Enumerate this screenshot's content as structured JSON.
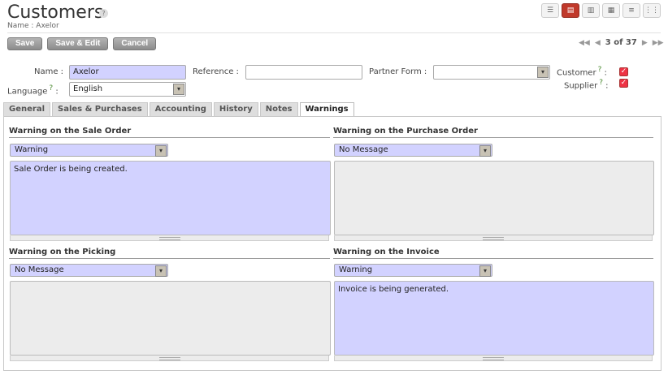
{
  "header": {
    "title": "Customers",
    "help": "?",
    "subtitle": "Name : Axelor"
  },
  "views": [
    {
      "icon": "list-view-icon",
      "glyph": "☰"
    },
    {
      "icon": "form-view-icon",
      "glyph": "▤"
    },
    {
      "icon": "chart-view-icon",
      "glyph": "▥"
    },
    {
      "icon": "calendar-view-icon",
      "glyph": "▦"
    },
    {
      "icon": "gantt-view-icon",
      "glyph": "≡"
    },
    {
      "icon": "kanban-view-icon",
      "glyph": "⋮⋮"
    }
  ],
  "toolbar": {
    "save_label": "Save",
    "save_edit_label": "Save & Edit",
    "cancel_label": "Cancel"
  },
  "pager": {
    "first": "◀◀",
    "prev": "◀",
    "count": "3 of 37",
    "next": "▶",
    "last": "▶▶"
  },
  "form": {
    "name_label": "Name :",
    "name_value": "Axelor",
    "reference_label": "Reference :",
    "reference_value": "",
    "partner_form_label": "Partner Form :",
    "partner_form_value": "",
    "language_label": "Language",
    "language_help": "?",
    "language_sep": ":",
    "language_value": "English",
    "customer_label": "Customer",
    "customer_help": "?",
    "customer_sep": ":",
    "customer_checked": true,
    "supplier_label": "Supplier",
    "supplier_help": "?",
    "supplier_sep": ":",
    "supplier_checked": true,
    "check_glyph": "✓",
    "arrow_glyph": "▾"
  },
  "tabs": [
    {
      "label": "General"
    },
    {
      "label": "Sales & Purchases"
    },
    {
      "label": "Accounting"
    },
    {
      "label": "History"
    },
    {
      "label": "Notes"
    },
    {
      "label": "Warnings",
      "active": true
    }
  ],
  "warnings": {
    "sale": {
      "title": "Warning on the Sale Order",
      "select": "Warning",
      "text": "Sale Order is being created."
    },
    "purchase": {
      "title": "Warning on the Purchase Order",
      "select": "No Message",
      "text": ""
    },
    "picking": {
      "title": "Warning on the Picking",
      "select": "No Message",
      "text": ""
    },
    "invoice": {
      "title": "Warning on the Invoice",
      "select": "Warning",
      "text": "Invoice is being generated."
    }
  },
  "colors": {
    "required_field": "#d2d2ff",
    "active_view": "#c0392b",
    "button": "#9a9a9a",
    "checkbox": "#e34444"
  }
}
